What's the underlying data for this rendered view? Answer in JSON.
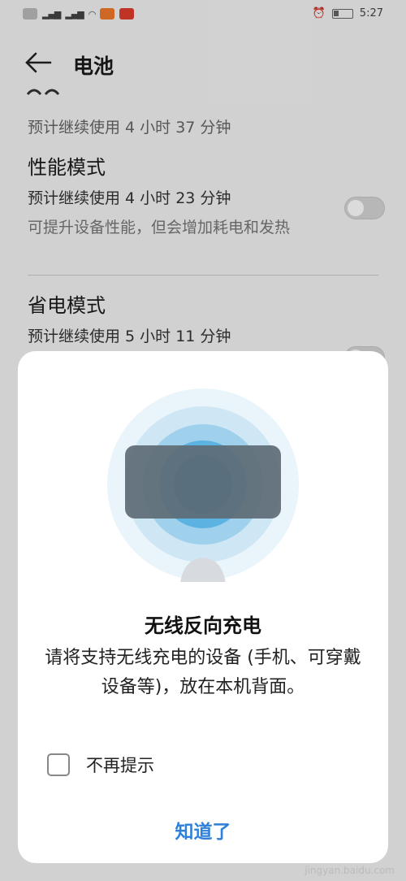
{
  "status_bar": {
    "time": "5:27"
  },
  "header": {
    "title": "电池"
  },
  "battery_summary": {
    "estimate": "预计继续使用 4 小时 37 分钟"
  },
  "performance_mode": {
    "title": "性能模式",
    "estimate": "预计继续使用 4 小时 23 分钟",
    "description": "可提升设备性能，但会增加耗电和发热",
    "enabled": false
  },
  "power_saving_mode": {
    "title": "省电模式",
    "estimate": "预计继续使用 5 小时 11 分钟",
    "enabled": false
  },
  "dialog": {
    "title": "无线反向充电",
    "message": "请将支持无线充电的设备 (手机、可穿戴设备等)，放在本机背面。",
    "checkbox_label": "不再提示",
    "checkbox_checked": false,
    "ok_button": "知道了"
  },
  "colors": {
    "accent": "#2f80d8",
    "ripple_center": "#1e9bd7",
    "device_gray": "#6b7780"
  },
  "watermark": "jingyan.baidu.com"
}
